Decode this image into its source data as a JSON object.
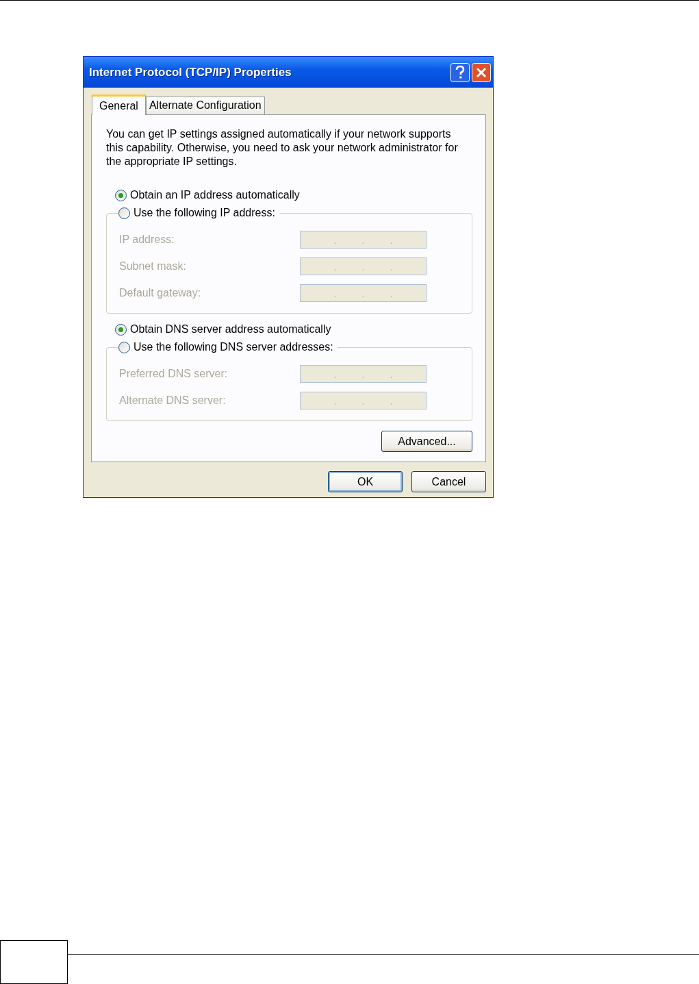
{
  "window": {
    "title": "Internet Protocol (TCP/IP) Properties"
  },
  "tabs": [
    {
      "label": "General",
      "selected": true
    },
    {
      "label": "Alternate Configuration",
      "selected": false
    }
  ],
  "description": "You can get IP settings assigned automatically if your network supports this capability. Otherwise, you need to ask your network administrator for the appropriate IP settings.",
  "sections": [
    {
      "auto_option": {
        "label": "Obtain an IP address automatically",
        "selected": true
      },
      "manual_option": {
        "label": "Use the following IP address:",
        "selected": false
      },
      "fields": [
        {
          "label": "IP address:",
          "disabled": true,
          "dots": [
            ".",
            ".",
            "."
          ]
        },
        {
          "label": "Subnet mask:",
          "disabled": true,
          "dots": [
            ".",
            ".",
            "."
          ]
        },
        {
          "label": "Default gateway:",
          "disabled": true,
          "dots": [
            ".",
            ".",
            "."
          ]
        }
      ]
    },
    {
      "auto_option": {
        "label": "Obtain DNS server address automatically",
        "selected": true
      },
      "manual_option": {
        "label": "Use the following DNS server addresses:",
        "selected": false
      },
      "fields": [
        {
          "label": "Preferred DNS server:",
          "disabled": true,
          "dots": [
            ".",
            ".",
            "."
          ]
        },
        {
          "label": "Alternate DNS server:",
          "disabled": true,
          "dots": [
            ".",
            ".",
            "."
          ]
        }
      ]
    }
  ],
  "advanced_button": "Advanced...",
  "footer_buttons": [
    {
      "label": "OK",
      "default": true
    },
    {
      "label": "Cancel",
      "default": false
    }
  ]
}
